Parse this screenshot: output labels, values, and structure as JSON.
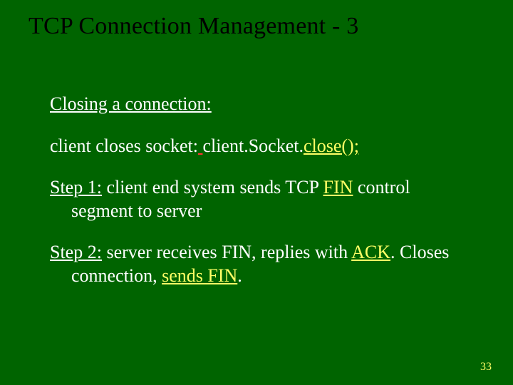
{
  "title": "TCP Connection Management - 3",
  "closing_heading": "Closing a connection:",
  "line2": {
    "a": "client closes socket:",
    "space": " ",
    "b": "client.Socket.",
    "c": "close();"
  },
  "step1": {
    "label": "Step 1:",
    "t1": " client end system sends TCP ",
    "fin": "FIN",
    "t2": " control segment to server"
  },
  "step2": {
    "label": "Step 2:",
    "t1": " server receives ",
    "fin": "FIN",
    "t2": ", replies with ",
    "ack": "ACK",
    "t3": ". Closes connection, ",
    "sends_fin": "sends FIN",
    "t4": "."
  },
  "page_number": "33"
}
